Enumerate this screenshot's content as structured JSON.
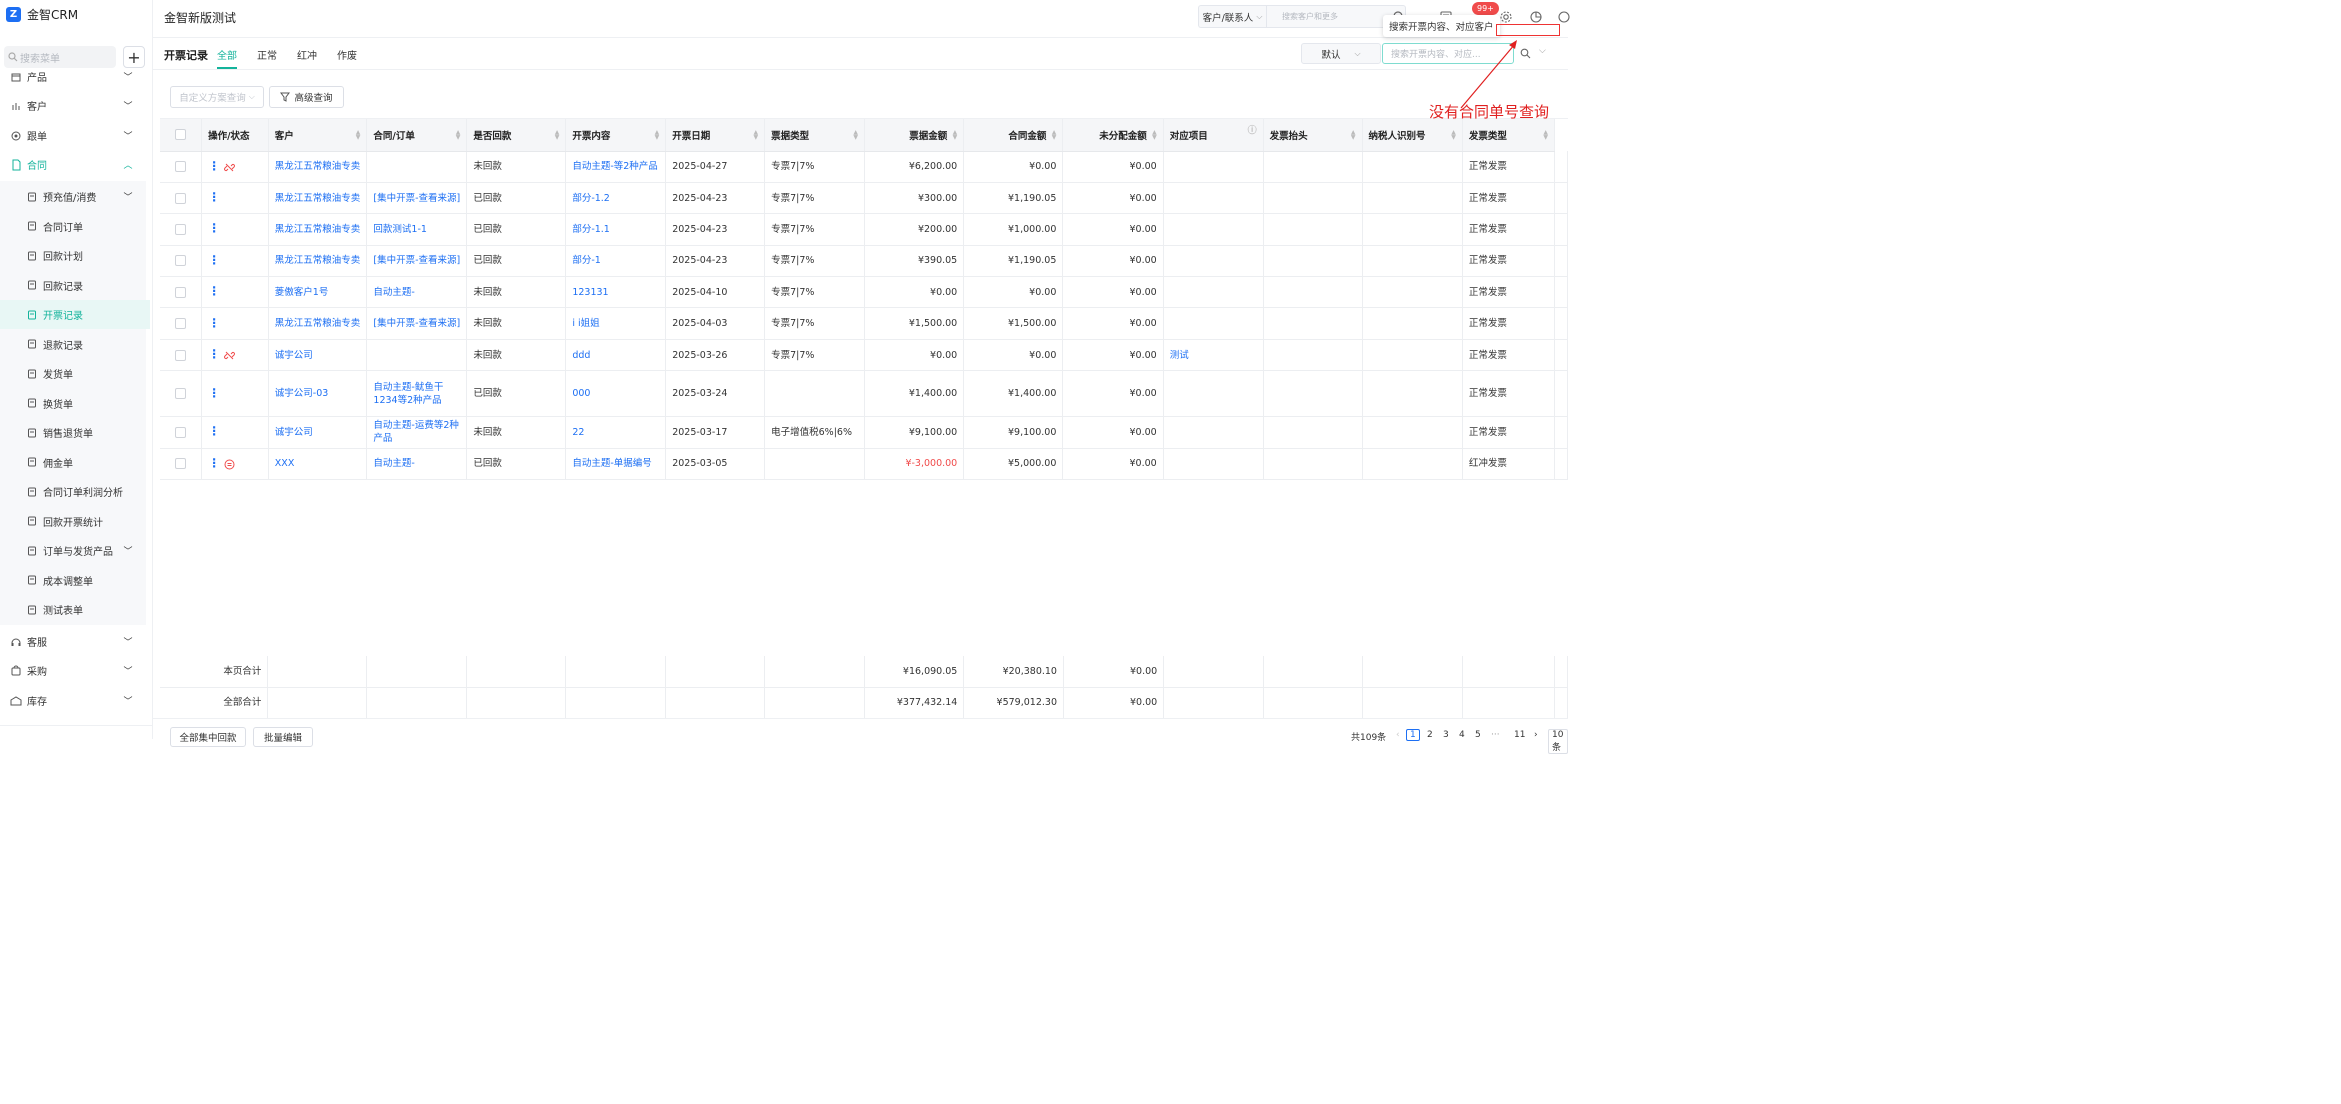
{
  "app": {
    "logo_text": "金智CRM",
    "title": "金智新版测试",
    "notification_badge": "99+"
  },
  "header": {
    "search_type": "客户/联系人",
    "search_placeholder": "搜索客户和更多"
  },
  "sidebar": {
    "search_placeholder": "搜索菜单",
    "items": [
      {
        "label": "产品",
        "icon": "box-icon",
        "expandable": true
      },
      {
        "label": "客户",
        "icon": "chart-icon",
        "expandable": true
      },
      {
        "label": "跟单",
        "icon": "target-icon",
        "expandable": true
      },
      {
        "label": "合同",
        "icon": "document-icon",
        "expandable": true,
        "expanded": true
      }
    ],
    "contract_sub": [
      {
        "label": "预充值/消费",
        "icon": "wallet-icon",
        "expandable": true
      },
      {
        "label": "合同订单",
        "icon": "file-icon"
      },
      {
        "label": "回款计划",
        "icon": "calendar-icon"
      },
      {
        "label": "回款记录",
        "icon": "receipt-icon"
      },
      {
        "label": "开票记录",
        "icon": "invoice-icon",
        "active": true
      },
      {
        "label": "退款记录",
        "icon": "refund-icon"
      },
      {
        "label": "发货单",
        "icon": "truck-icon"
      },
      {
        "label": "换货单",
        "icon": "exchange-icon"
      },
      {
        "label": "销售退货单",
        "icon": "return-icon"
      },
      {
        "label": "佣金单",
        "icon": "commission-icon"
      },
      {
        "label": "合同订单利润分析",
        "icon": "analysis-icon"
      },
      {
        "label": "回款开票统计",
        "icon": "stats-icon"
      },
      {
        "label": "订单与发货产品",
        "icon": "package-icon",
        "expandable": true
      },
      {
        "label": "成本调整单",
        "icon": "adjust-icon"
      },
      {
        "label": "测试表单",
        "icon": "form-icon"
      }
    ],
    "bottom_items": [
      {
        "label": "客服",
        "icon": "headset-icon",
        "expandable": true
      },
      {
        "label": "采购",
        "icon": "cart-icon",
        "expandable": true
      },
      {
        "label": "库存",
        "icon": "warehouse-icon",
        "expandable": true
      }
    ]
  },
  "page": {
    "title": "开票记录",
    "tabs": [
      "全部",
      "正常",
      "红冲",
      "作废"
    ],
    "active_tab": "全部",
    "view_select": "默认",
    "search_placeholder": "搜索开票内容、对应...",
    "tooltip": "搜索开票内容、对应客户",
    "annotation": "没有合同单号查询",
    "custom_query_placeholder": "自定义方案查询",
    "advanced_query": "高级查询"
  },
  "table": {
    "columns": [
      "操作/状态",
      "客户",
      "合同/订单",
      "是否回款",
      "开票内容",
      "开票日期",
      "票据类型",
      "票据金额",
      "合同金额",
      "未分配金额",
      "对应项目",
      "发票抬头",
      "纳税人识别号",
      "发票类型"
    ],
    "rows": [
      {
        "status_icon": "unlink",
        "customer": "黑龙江五常粮油专卖",
        "contract": "",
        "paid": "未回款",
        "content": "自动主题-等2种产品",
        "date": "2025-04-27",
        "ticket_type": "专票7|7%",
        "ticket_amount": "¥6,200.00",
        "contract_amount": "¥0.00",
        "unallocated": "¥0.00",
        "project": "",
        "invoice_title": "",
        "tax_id": "",
        "invoice_type": "正常发票"
      },
      {
        "status_icon": "",
        "customer": "黑龙江五常粮油专卖",
        "contract": "[集中开票-查看来源]",
        "paid": "已回款",
        "content": "部分-1.2",
        "date": "2025-04-23",
        "ticket_type": "专票7|7%",
        "ticket_amount": "¥300.00",
        "contract_amount": "¥1,190.05",
        "unallocated": "¥0.00",
        "project": "",
        "invoice_title": "",
        "tax_id": "",
        "invoice_type": "正常发票"
      },
      {
        "status_icon": "",
        "customer": "黑龙江五常粮油专卖",
        "contract": "回款测试1-1",
        "paid": "已回款",
        "content": "部分-1.1",
        "date": "2025-04-23",
        "ticket_type": "专票7|7%",
        "ticket_amount": "¥200.00",
        "contract_amount": "¥1,000.00",
        "unallocated": "¥0.00",
        "project": "",
        "invoice_title": "",
        "tax_id": "",
        "invoice_type": "正常发票"
      },
      {
        "status_icon": "",
        "customer": "黑龙江五常粮油专卖",
        "contract": "[集中开票-查看来源]",
        "paid": "已回款",
        "content": "部分-1",
        "date": "2025-04-23",
        "ticket_type": "专票7|7%",
        "ticket_amount": "¥390.05",
        "contract_amount": "¥1,190.05",
        "unallocated": "¥0.00",
        "project": "",
        "invoice_title": "",
        "tax_id": "",
        "invoice_type": "正常发票"
      },
      {
        "status_icon": "",
        "customer": "菱傲客户1号",
        "contract": "自动主题-",
        "paid": "未回款",
        "content": "123131",
        "date": "2025-04-10",
        "ticket_type": "专票7|7%",
        "ticket_amount": "¥0.00",
        "contract_amount": "¥0.00",
        "unallocated": "¥0.00",
        "project": "",
        "invoice_title": "",
        "tax_id": "",
        "invoice_type": "正常发票"
      },
      {
        "status_icon": "",
        "customer": "黑龙江五常粮油专卖",
        "contract": "[集中开票-查看来源]",
        "paid": "未回款",
        "content": "i i姐姐",
        "date": "2025-04-03",
        "ticket_type": "专票7|7%",
        "ticket_amount": "¥1,500.00",
        "contract_amount": "¥1,500.00",
        "unallocated": "¥0.00",
        "project": "",
        "invoice_title": "",
        "tax_id": "",
        "invoice_type": "正常发票"
      },
      {
        "status_icon": "unlink",
        "customer": "诚宇公司",
        "contract": "",
        "paid": "未回款",
        "content": "ddd",
        "date": "2025-03-26",
        "ticket_type": "专票7|7%",
        "ticket_amount": "¥0.00",
        "contract_amount": "¥0.00",
        "unallocated": "¥0.00",
        "project": "测试",
        "invoice_title": "",
        "tax_id": "",
        "invoice_type": "正常发票"
      },
      {
        "status_icon": "",
        "customer": "诚宇公司-03",
        "contract": "自动主题-鱿鱼干1234等2种产品",
        "paid": "已回款",
        "content": "000",
        "date": "2025-03-24",
        "ticket_type": "",
        "ticket_amount": "¥1,400.00",
        "contract_amount": "¥1,400.00",
        "unallocated": "¥0.00",
        "project": "",
        "invoice_title": "",
        "tax_id": "",
        "invoice_type": "正常发票"
      },
      {
        "status_icon": "",
        "customer": "诚宇公司",
        "contract": "自动主题-运费等2种产品",
        "paid": "未回款",
        "content": "22",
        "date": "2025-03-17",
        "ticket_type": "电子增值税6%|6%",
        "ticket_amount": "¥9,100.00",
        "contract_amount": "¥9,100.00",
        "unallocated": "¥0.00",
        "project": "",
        "invoice_title": "",
        "tax_id": "",
        "invoice_type": "正常发票"
      },
      {
        "status_icon": "red",
        "customer": "XXX",
        "contract": "自动主题-",
        "paid": "已回款",
        "content": "自动主题-单据编号",
        "date": "2025-03-05",
        "ticket_type": "",
        "ticket_amount": "¥-3,000.00",
        "contract_amount": "¥5,000.00",
        "unallocated": "¥0.00",
        "project": "",
        "invoice_title": "",
        "tax_id": "",
        "invoice_type": "红冲发票"
      }
    ],
    "summary": [
      {
        "label": "本页合计",
        "ticket_amount": "¥16,090.05",
        "contract_amount": "¥20,380.10",
        "unallocated": "¥0.00"
      },
      {
        "label": "全部合计",
        "ticket_amount": "¥377,432.14",
        "contract_amount": "¥579,012.30",
        "unallocated": "¥0.00"
      }
    ]
  },
  "footer": {
    "buttons": [
      "全部集中回款",
      "批量编辑"
    ],
    "total": "共109条",
    "pages": [
      "1",
      "2",
      "3",
      "4",
      "5",
      "···",
      "11"
    ],
    "current_page": "1",
    "page_size": "10 条"
  },
  "colors": {
    "accent": "#13b39b",
    "link": "#1d6ff3",
    "danger": "#f04b4b"
  }
}
